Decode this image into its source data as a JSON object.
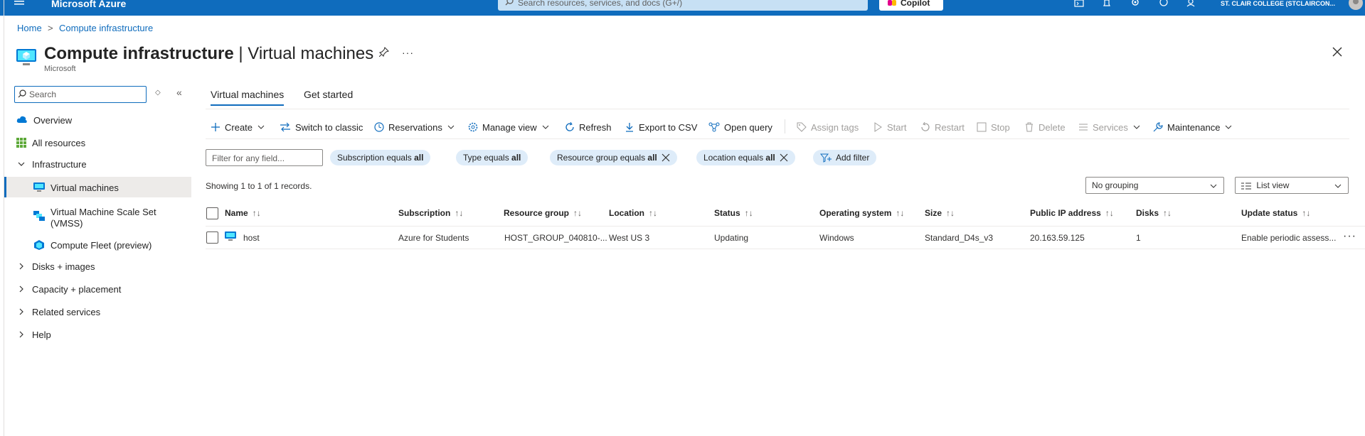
{
  "topbar": {
    "brand": "Microsoft Azure",
    "search_placeholder": "Search resources, services, and docs (G+/)",
    "copilot_label": "Copilot",
    "tenant": "ST. CLAIR COLLEGE (STCLAIRCON..."
  },
  "breadcrumb": {
    "home": "Home",
    "sep": ">",
    "current": "Compute infrastructure"
  },
  "page": {
    "title_bold": "Compute infrastructure",
    "title_rest": " | Virtual machines",
    "subtitle": "Microsoft"
  },
  "sidebar": {
    "search_placeholder": "Search",
    "items": [
      {
        "label": "Overview",
        "icon": "cloud-overview-icon"
      },
      {
        "label": "All resources",
        "icon": "grid-icon"
      },
      {
        "label": "Infrastructure",
        "icon": "chevron-down-icon"
      },
      {
        "label": "Virtual machines",
        "icon": "vm-icon"
      },
      {
        "label": "Virtual Machine Scale Set (VMSS)",
        "icon": "vmss-icon"
      },
      {
        "label": "Compute Fleet (preview)",
        "icon": "fleet-icon"
      },
      {
        "label": "Disks + images",
        "icon": "chevron-right-icon"
      },
      {
        "label": "Capacity + placement",
        "icon": "chevron-right-icon"
      },
      {
        "label": "Related services",
        "icon": "chevron-right-icon"
      },
      {
        "label": "Help",
        "icon": "chevron-right-icon"
      }
    ]
  },
  "tabs": [
    "Virtual machines",
    "Get started"
  ],
  "toolbar": {
    "create": "Create",
    "switch_classic": "Switch to classic",
    "reservations": "Reservations",
    "manage_view": "Manage view",
    "refresh": "Refresh",
    "export_csv": "Export to CSV",
    "open_query": "Open query",
    "assign_tags": "Assign tags",
    "start": "Start",
    "restart": "Restart",
    "stop": "Stop",
    "delete": "Delete",
    "services": "Services",
    "maintenance": "Maintenance"
  },
  "filters": {
    "placeholder": "Filter for any field...",
    "pills": [
      {
        "prefix": "Subscription equals ",
        "value": "all"
      },
      {
        "prefix": "Type equals ",
        "value": "all"
      },
      {
        "prefix": "Resource group equals ",
        "value": "all"
      },
      {
        "prefix": "Location equals ",
        "value": "all"
      }
    ],
    "add_filter": "Add filter"
  },
  "records_text": "Showing 1 to 1 of 1 records.",
  "grouping": "No grouping",
  "view": "List view",
  "table": {
    "headers": [
      "Name",
      "Subscription",
      "Resource group",
      "Location",
      "Status",
      "Operating system",
      "Size",
      "Public IP address",
      "Disks",
      "Update status"
    ],
    "sort_glyph": "↑↓",
    "rows": [
      {
        "name": "host",
        "subscription": "Azure for Students",
        "resource_group": "HOST_GROUP_040810-...",
        "location": "West US 3",
        "status": "Updating",
        "os": "Windows",
        "size": "Standard_D4s_v3",
        "public_ip": "20.163.59.125",
        "disks": "1",
        "update_status": "Enable periodic assess..."
      }
    ]
  },
  "colors": {
    "brand_blue": "#0f6cbd",
    "pill_bg": "#deecf9"
  }
}
